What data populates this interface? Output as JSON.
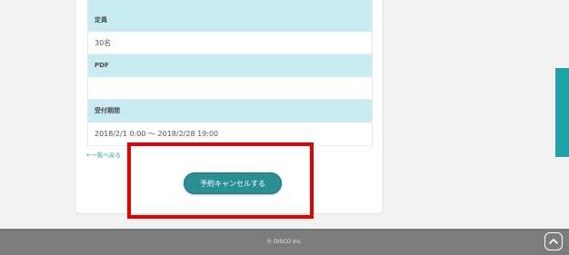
{
  "details": [
    {
      "label": "定員",
      "value": "30名"
    },
    {
      "label": "PDF",
      "value": ""
    },
    {
      "label": "受付期間",
      "value": "2018/2/1 0:00 〜 2018/2/28 19:00"
    }
  ],
  "back_link": "←一覧へ戻る",
  "cancel_button": "予約キャンセルする",
  "footer": {
    "copyright": "© DISCO Inc.",
    "to_top_icon": "chevron-up-icon"
  },
  "colors": {
    "accent": "#2a8e95",
    "table_header": "#c8ecf1",
    "highlight": "#e60000",
    "footer_bg": "#7c7c7c",
    "side_tab": "#1ba3a8"
  }
}
